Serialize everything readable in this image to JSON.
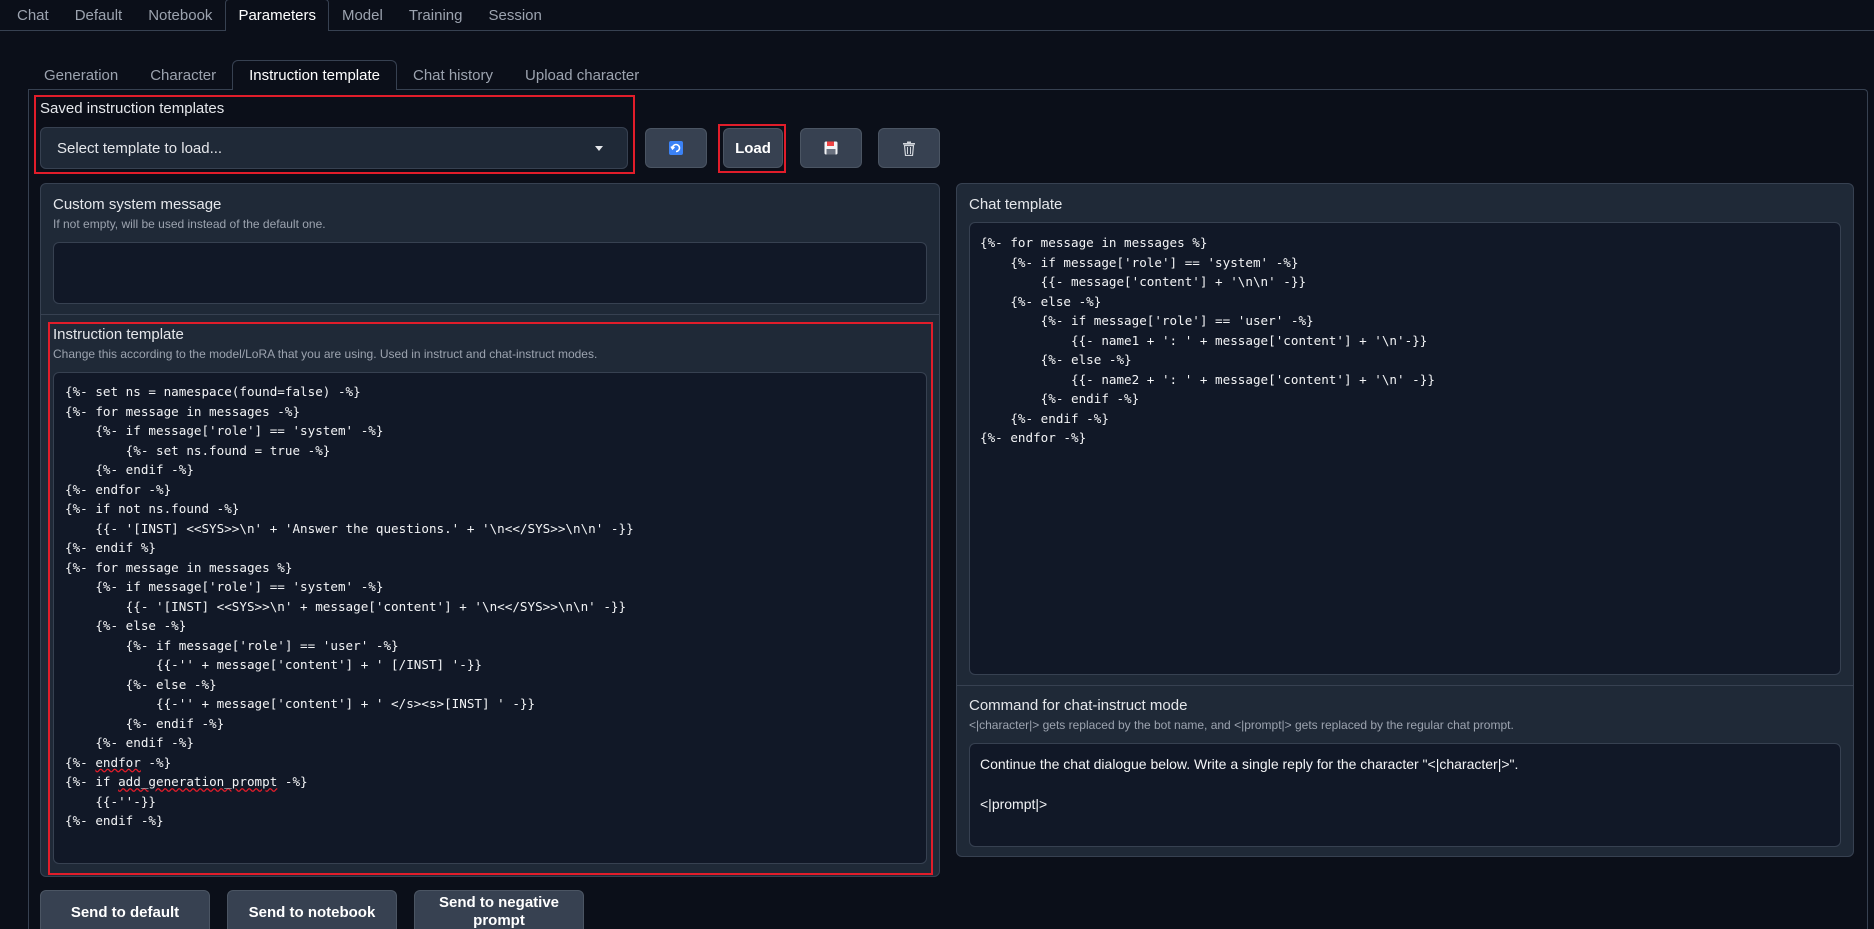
{
  "top_tabs": [
    "Chat",
    "Default",
    "Notebook",
    "Parameters",
    "Model",
    "Training",
    "Session"
  ],
  "sub_tabs": [
    "Generation",
    "Character",
    "Instruction template",
    "Chat history",
    "Upload character"
  ],
  "saved": {
    "label": "Saved instruction templates",
    "dropdown_value": "Select template to load...",
    "load_label": "Load",
    "refresh_icon": "refresh-icon",
    "save_icon": "floppy-disk-icon",
    "delete_icon": "trash-icon"
  },
  "custom_system": {
    "label": "Custom system message",
    "info": "If not empty, will be used instead of the default one.",
    "value": ""
  },
  "instruction_template": {
    "label": "Instruction template",
    "info": "Change this according to the model/LoRA that you are using. Used in instruct and chat-instruct modes.",
    "code_before": "{%- set ns = namespace(found=false) -%}\n{%- for message in messages -%}\n    {%- if message['role'] == 'system' -%}\n        {%- set ns.found = true -%}\n    {%- endif -%}\n{%- endfor -%}\n{%- if not ns.found -%}\n    {{- '[INST] <<SYS>>\\n' + 'Answer the questions.' + '\\n<</SYS>>\\n\\n' -}}\n{%- endif %}\n{%- for message in messages %}\n    {%- if message['role'] == 'system' -%}\n        {{- '[INST] <<SYS>>\\n' + message['content'] + '\\n<</SYS>>\\n\\n' -}}\n    {%- else -%}\n        {%- if message['role'] == 'user' -%}\n            {{-'' + message['content'] + ' [/INST] '-}}\n        {%- else -%}\n            {{-'' + message['content'] + ' </s><s>[INST] ' -}}\n        {%- endif -%}\n    {%- endif -%}\n",
    "line_endfor_pre": "{%- ",
    "line_endfor_word": "endfor",
    "line_endfor_post": " -%}\n",
    "line_if_pre": "{%- if ",
    "line_if_word": "add_generation_prompt",
    "line_if_post": " -%}\n",
    "code_after": "    {{-''-}}\n{%- endif -%}"
  },
  "chat_template": {
    "label": "Chat template",
    "code": "{%- for message in messages %}\n    {%- if message['role'] == 'system' -%}\n        {{- message['content'] + '\\n\\n' -}}\n    {%- else -%}\n        {%- if message['role'] == 'user' -%}\n            {{- name1 + ': ' + message['content'] + '\\n'-}}\n        {%- else -%}\n            {{- name2 + ': ' + message['content'] + '\\n' -}}\n        {%- endif -%}\n    {%- endif -%}\n{%- endfor -%}"
  },
  "chat_instruct": {
    "label": "Command for chat-instruct mode",
    "info": "<|character|> gets replaced by the bot name, and <|prompt|> gets replaced by the regular chat prompt.",
    "value": "Continue the chat dialogue below. Write a single reply for the character \"<|character|>\".\n\n<|prompt|>"
  },
  "bottom_buttons": [
    "Send to default",
    "Send to notebook",
    "Send to negative prompt"
  ],
  "colors": {
    "background": "#0b0f19",
    "panel": "#1f2937",
    "textbox": "#111827",
    "button": "#374151",
    "highlight_box": "#e11d2a"
  }
}
